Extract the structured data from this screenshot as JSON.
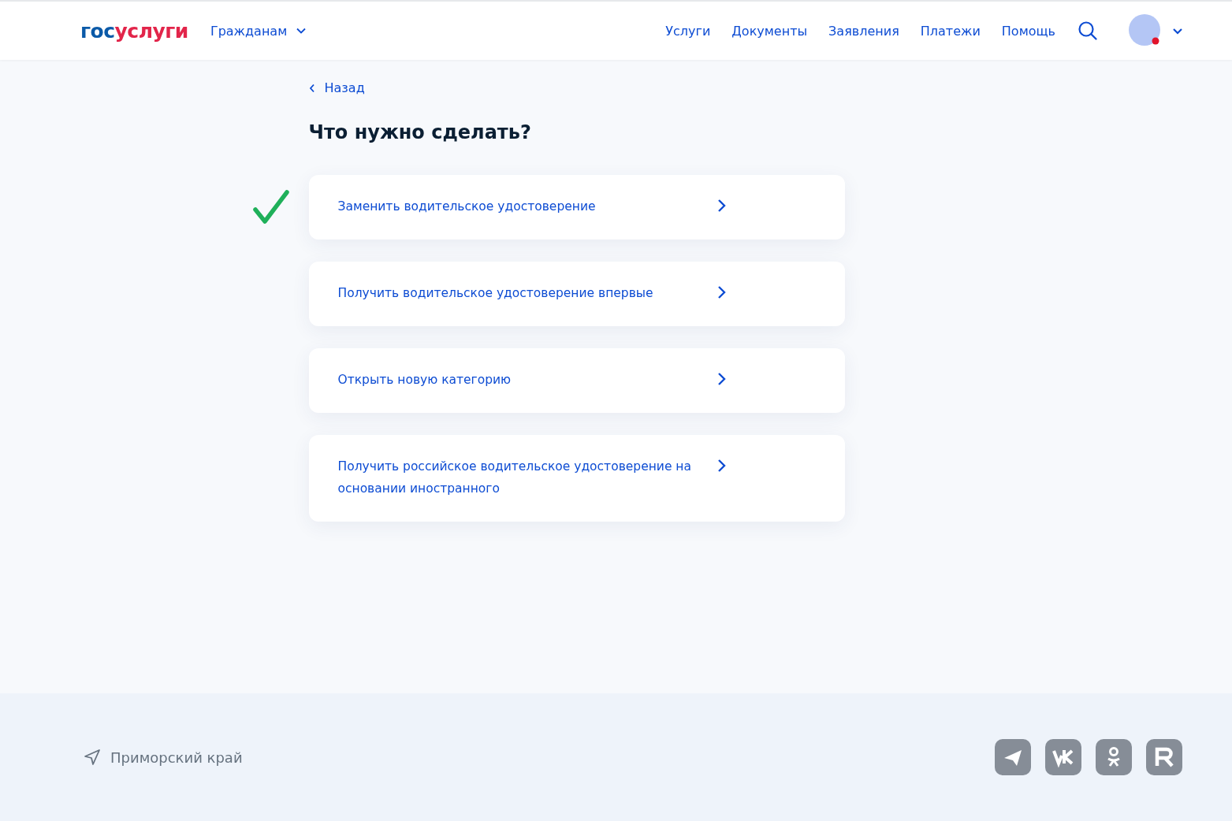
{
  "header": {
    "logo": {
      "part_1": "гос",
      "part_2": "услуги"
    },
    "audience_menu": "Гражданам",
    "nav": [
      "Услуги",
      "Документы",
      "Заявления",
      "Платежи",
      "Помощь"
    ],
    "profile": {
      "has_notification": true
    }
  },
  "back_link": "Назад",
  "title": "Что нужно сделать?",
  "options": [
    {
      "label": "Заменить водительское удостоверение",
      "marked": true
    },
    {
      "label": "Получить водительское удостоверение впервые",
      "marked": false
    },
    {
      "label": "Открыть новую категорию",
      "marked": false
    },
    {
      "label": "Получить российское водительское удостоверение на основании иностранного",
      "marked": false
    }
  ],
  "footer": {
    "region": "Приморский край",
    "socials": [
      {
        "kind": "telegram"
      },
      {
        "kind": "vk"
      },
      {
        "kind": "ok"
      },
      {
        "kind": "rutube"
      }
    ]
  }
}
